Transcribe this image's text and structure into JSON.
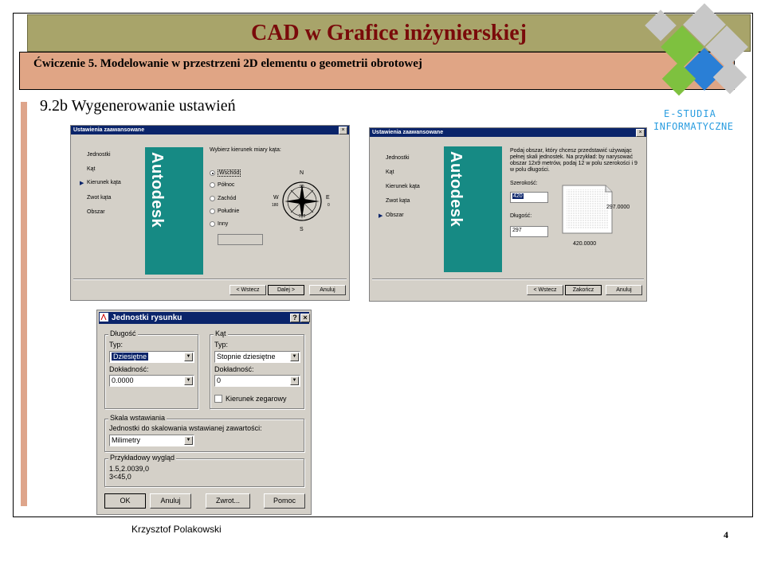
{
  "slide": {
    "title": "CAD w Grafice inżynierskiej",
    "subtitle": "Ćwiczenie 5. Modelowanie w przestrzeni 2D elementu o geometrii obrotowej",
    "section_title": "9.2b Wygenerowanie ustawień",
    "author": "Krzysztof Polakowski",
    "page_number": "4"
  },
  "logo": {
    "line1": "E-STUDIA",
    "line2": "INFORMATYCZNE",
    "colors": [
      "#7ec13f",
      "#2a7fd6",
      "#c8c8c8"
    ]
  },
  "dialog1": {
    "title": "Ustawienia zaawansowane",
    "close": "×",
    "nav": [
      "Jednostki",
      "Kąt",
      "Kierunek kąta",
      "Zwot kąta",
      "Obszar"
    ],
    "active_nav": "Kierunek kąta",
    "brand": "Autodesk",
    "prompt": "Wybierz kierunek miary kąta:",
    "options": [
      "Wschód",
      "Północ",
      "Zachód",
      "Południe",
      "Inny"
    ],
    "selected_option": "Wschód",
    "compass": {
      "n": "N",
      "s": "S",
      "e": "E",
      "w": "W",
      "deg_n": "90",
      "deg_s": "270",
      "deg_e": "0",
      "deg_w": "180"
    },
    "buttons": [
      "< Wstecz",
      "Dalej >",
      "Anuluj"
    ]
  },
  "dialog2": {
    "title": "Ustawienia zaawansowane",
    "close": "×",
    "nav": [
      "Jednostki",
      "Kąt",
      "Kierunek kąta",
      "Zwot kąta",
      "Obszar"
    ],
    "active_nav": "Obszar",
    "brand": "Autodesk",
    "description": "Podaj obszar, który chcesz przedstawić używając pełnej skali jednostek. Na przykład: by narysować obszar 12x9 metrów, podaj 12 w polu szerokości i 9 w polu długości.",
    "width_label": "Szerokość:",
    "width_value": "420",
    "length_label": "Długość:",
    "length_value": "297",
    "preview_height": "297.0000",
    "preview_width": "420.0000",
    "buttons": [
      "< Wstecz",
      "Zakończ",
      "Anuluj"
    ]
  },
  "dialog3": {
    "title": "Jednostki rysunku",
    "help": "?",
    "close": "×",
    "length_group": "Długość",
    "length_type_label": "Typ:",
    "length_type_value": "Dziesiętne",
    "length_precision_label": "Dokładność:",
    "length_precision_value": "0.0000",
    "angle_group": "Kąt",
    "angle_type_label": "Typ:",
    "angle_type_value": "Stopnie dziesiętne",
    "angle_precision_label": "Dokładność:",
    "angle_precision_value": "0",
    "clockwise_label": "Kierunek zegarowy",
    "scale_group": "Skala wstawiania",
    "scale_label": "Jednostki do skalowania wstawianej zawartości:",
    "scale_value": "Milimetry",
    "sample_group": "Przykładowy wygląd",
    "sample_line1": "1.5,2.0039,0",
    "sample_line2": "3<45,0",
    "buttons": [
      "OK",
      "Anuluj",
      "Zwrot...",
      "Pomoc"
    ]
  }
}
